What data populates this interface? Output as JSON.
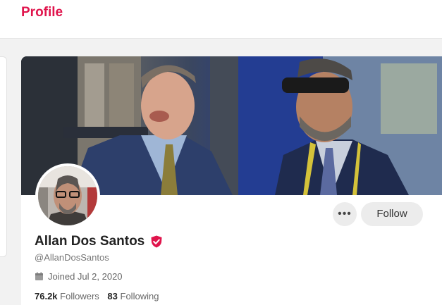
{
  "header": {
    "title": "Profile"
  },
  "profile": {
    "display_name": "Allan Dos Santos",
    "handle": "@AllanDosSantos",
    "joined": "Joined Jul 2, 2020",
    "followers_count": "76.2k",
    "followers_label": "Followers",
    "following_count": "83",
    "following_label": "Following",
    "follow_label": "Follow",
    "more_label": "•••"
  },
  "colors": {
    "accent": "#e0144c",
    "button_bg": "#ececec"
  },
  "icons": {
    "verified": "verified-badge-icon",
    "joined": "calendar-icon",
    "more": "more-dots-icon"
  }
}
